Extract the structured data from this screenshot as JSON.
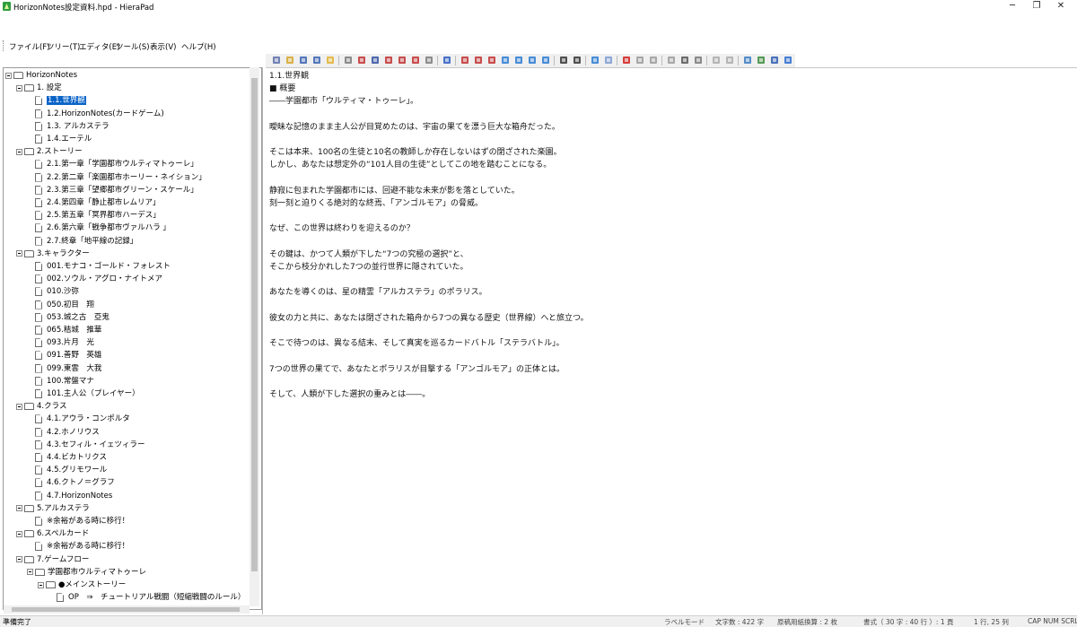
{
  "window": {
    "title": "HorizonNotes設定資料.hpd - HieraPad",
    "minimize": "─",
    "restore": "❐",
    "close": "✕"
  },
  "menu": [
    "ファイル(F)",
    "ツリー(T)",
    "エディタ(E)",
    "ツール(S)",
    "表示(V)",
    "ヘルプ(H)"
  ],
  "toolbar": {
    "icons": [
      "new-doc-icon",
      "open-folder-icon",
      "save-icon",
      "save-all-icon",
      "open-icon",
      "print-preview-icon",
      "cut-node-icon",
      "copy-node-icon",
      "paste-node-icon",
      "paste-child-icon",
      "delete-node-icon",
      "find-icon",
      "help-icon",
      "add-sibling-icon",
      "add-child-icon",
      "add-node-icon",
      "move-up-icon",
      "move-down-icon",
      "move-left-icon",
      "move-right-icon",
      "expand-icon",
      "collapse-icon",
      "undo-icon",
      "redo-icon",
      "delete-icon",
      "cut-icon",
      "copy-icon",
      "paste-icon",
      "find-text-icon",
      "replace-icon",
      "undo-text-icon",
      "redo-text-icon",
      "settings-icon",
      "table-icon",
      "link-icon",
      "web-icon"
    ]
  },
  "tree": [
    {
      "level": 0,
      "type": "folder",
      "label": "HorizonNotes",
      "expanded": true
    },
    {
      "level": 1,
      "type": "folder",
      "label": "1. 設定",
      "expanded": true
    },
    {
      "level": 2,
      "type": "doc",
      "label": "1.1.世界観",
      "selected": true
    },
    {
      "level": 2,
      "type": "doc",
      "label": "1.2.HorizonNotes(カードゲーム)"
    },
    {
      "level": 2,
      "type": "doc",
      "label": "1.3. アルカステラ"
    },
    {
      "level": 2,
      "type": "doc",
      "label": "1.4.エーテル"
    },
    {
      "level": 1,
      "type": "folder",
      "label": "2.ストーリー",
      "expanded": true
    },
    {
      "level": 2,
      "type": "doc",
      "label": "2.1.第一章「学園都市ウルティマトゥーレ」"
    },
    {
      "level": 2,
      "type": "doc",
      "label": "2.2.第二章「楽園都市ホーリー・ネイション」"
    },
    {
      "level": 2,
      "type": "doc",
      "label": "2.3.第三章「望郷都市グリーン・スケール」"
    },
    {
      "level": 2,
      "type": "doc",
      "label": "2.4.第四章「静止都市レムリア」"
    },
    {
      "level": 2,
      "type": "doc",
      "label": "2.5.第五章「冥界都市ハーデス」"
    },
    {
      "level": 2,
      "type": "doc",
      "label": "2.6.第六章「戦争都市ヴァルハラ 」"
    },
    {
      "level": 2,
      "type": "doc",
      "label": "2.7.終章「地平線の記録」"
    },
    {
      "level": 1,
      "type": "folder",
      "label": "3.キャラクター",
      "expanded": true
    },
    {
      "level": 2,
      "type": "doc",
      "label": "001.モナコ・ゴールド・フォレスト"
    },
    {
      "level": 2,
      "type": "doc",
      "label": "002.ソウル・アグロ・ナイトメア"
    },
    {
      "level": 2,
      "type": "doc",
      "label": "010.沙弥"
    },
    {
      "level": 2,
      "type": "doc",
      "label": "050.初目　翔"
    },
    {
      "level": 2,
      "type": "doc",
      "label": "053.城之古　亞鬼"
    },
    {
      "level": 2,
      "type": "doc",
      "label": "065.秸城　推華"
    },
    {
      "level": 2,
      "type": "doc",
      "label": "093.片月　光"
    },
    {
      "level": 2,
      "type": "doc",
      "label": "091.善野　英雄"
    },
    {
      "level": 2,
      "type": "doc",
      "label": "099.東雲　大我"
    },
    {
      "level": 2,
      "type": "doc",
      "label": "100.常盤マナ"
    },
    {
      "level": 2,
      "type": "doc",
      "label": "101.主人公（プレイヤー）"
    },
    {
      "level": 1,
      "type": "folder",
      "label": "4.クラス",
      "expanded": true
    },
    {
      "level": 2,
      "type": "doc",
      "label": "4.1.アウラ・コンポルタ"
    },
    {
      "level": 2,
      "type": "doc",
      "label": "4.2.ホノリウス"
    },
    {
      "level": 2,
      "type": "doc",
      "label": "4.3.セフィル・イェツィラー"
    },
    {
      "level": 2,
      "type": "doc",
      "label": "4.4.ビカトリクス"
    },
    {
      "level": 2,
      "type": "doc",
      "label": "4.5.グリモワール"
    },
    {
      "level": 2,
      "type": "doc",
      "label": "4.6.クトノ＝グラフ"
    },
    {
      "level": 2,
      "type": "doc",
      "label": "4.7.HorizonNotes"
    },
    {
      "level": 1,
      "type": "folder",
      "label": "5.アルカステラ",
      "expanded": true
    },
    {
      "level": 2,
      "type": "doc",
      "label": "※余裕がある時に移行！"
    },
    {
      "level": 1,
      "type": "folder",
      "label": "6.スペルカード",
      "expanded": true
    },
    {
      "level": 2,
      "type": "doc",
      "label": "※余裕がある時に移行！"
    },
    {
      "level": 1,
      "type": "folder",
      "label": "7.ゲームフロー",
      "expanded": true
    },
    {
      "level": 2,
      "type": "folder",
      "label": "学園都市ウルティマトゥーレ",
      "expanded": true
    },
    {
      "level": 3,
      "type": "folder",
      "label": "●メインストーリー",
      "expanded": true
    },
    {
      "level": 4,
      "type": "doc",
      "label": "OP　⇒　チュートリアル戦闘（短縮戦闘のルール）"
    }
  ],
  "editor": {
    "lines": [
      "1.1.世界観",
      "■ 概要",
      "――学園都市「ウルティマ・トゥーレ」。",
      "",
      "曖昧な記憶のまま主人公が目覚めたのは、宇宙の果てを漂う巨大な箱舟だった。",
      "",
      "そこは本来、100名の生徒と10名の教師しか存在しないはずの閉ざされた楽園。",
      "しかし、あなたは想定外の“101人目の生徒”としてこの地を踏むことになる。",
      "",
      "静寂に包まれた学園都市には、回避不能な未来が影を落としていた。",
      "刻一刻と迫りくる絶対的な終焉、「アンゴルモア」の脅威。",
      "",
      "なぜ、この世界は終わりを迎えるのか？",
      "",
      "その鍵は、かつて人類が下した“7つの究極の選択”と、",
      "そこから枝分かれした7つの並行世界に隠されていた。",
      "",
      "あなたを導くのは、星の精霊「アルカステラ」のポラリス。",
      "",
      "彼女の力と共に、あなたは閉ざされた箱舟から7つの異なる歴史（世界線）へと旅立つ。",
      "",
      "そこで待つのは、異なる結末、そして真実を巡るカードバトル「ステラバトル」。",
      "",
      "7つの世界の果てで、あなたとポラリスが目撃する「アンゴルモア」の正体とは。",
      "",
      "そして、人類が下した選択の重みとは――。"
    ]
  },
  "status": {
    "ready": "準備完了",
    "mode": "ラベルモード",
    "chars": "文字数 : 422 字",
    "manuscript": "原稿用紙換算 : 2 枚",
    "format": "書式（ 30 字 : 40 行 ）: 1 頁",
    "position": "1 行, 25 列",
    "keys": "CAP  NUM  SCRL"
  }
}
